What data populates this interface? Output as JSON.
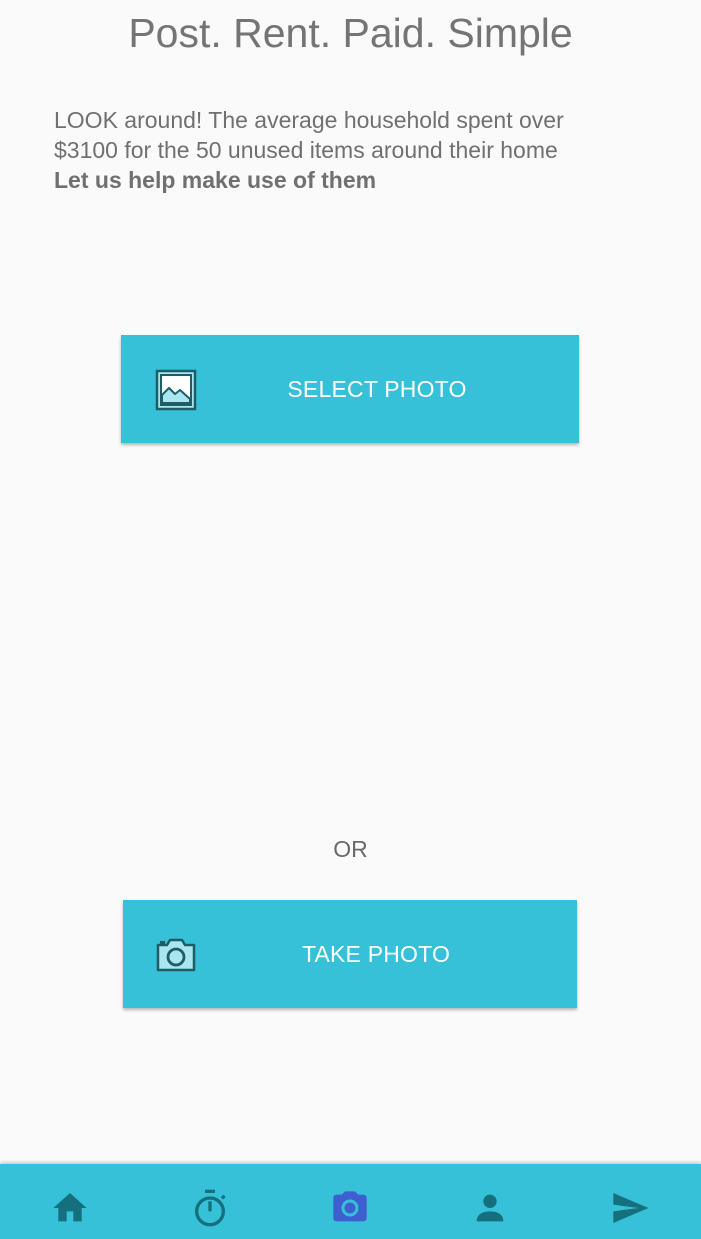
{
  "header": {
    "title": "Post. Rent. Paid. Simple"
  },
  "intro": {
    "line1": "LOOK around! The average household spent over",
    "line2": "$3100 for the 50 unused items around their home",
    "bold": "Let us help make use of them"
  },
  "actions": {
    "select_photo": {
      "label": "SELECT PHOTO",
      "icon": "image-icon"
    },
    "separator": "OR",
    "take_photo": {
      "label": "TAKE PHOTO",
      "icon": "camera-icon"
    }
  },
  "bottom_nav": {
    "items": [
      {
        "icon": "home-icon",
        "active": false
      },
      {
        "icon": "timer-icon",
        "active": false
      },
      {
        "icon": "camera-icon",
        "active": true
      },
      {
        "icon": "person-icon",
        "active": false
      },
      {
        "icon": "send-icon",
        "active": false
      }
    ]
  },
  "colors": {
    "accent": "#37c1d8",
    "nav_icon": "#156f7d",
    "nav_icon_active": "#3d5fd0",
    "text": "#707070",
    "background": "#fafafa"
  }
}
